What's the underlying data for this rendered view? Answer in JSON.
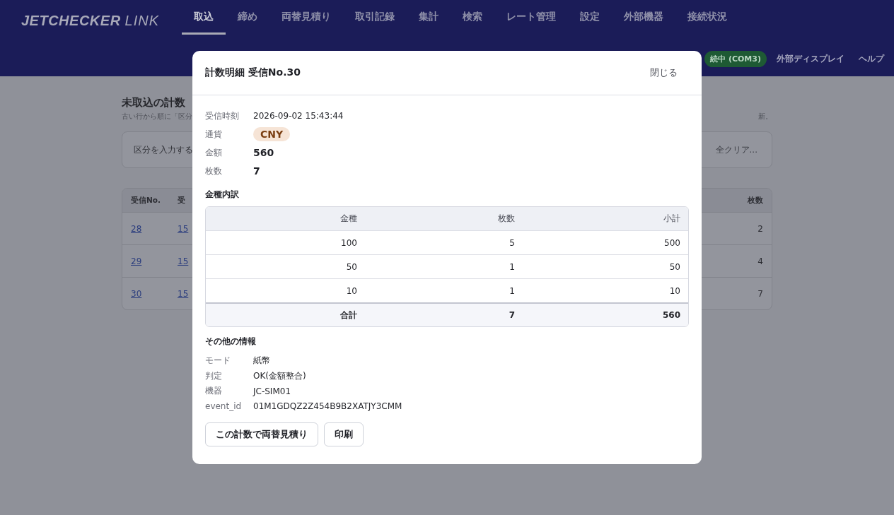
{
  "header": {
    "logo": {
      "strong": "JETCHECKER",
      "light": "LINK"
    },
    "tabs": [
      {
        "label": "取込",
        "selected": true
      },
      {
        "label": "締め",
        "selected": false
      },
      {
        "label": "両替見積り",
        "selected": false
      },
      {
        "label": "取引記録",
        "selected": false
      },
      {
        "label": "集計",
        "selected": false
      },
      {
        "label": "検索",
        "selected": false
      },
      {
        "label": "レート管理",
        "selected": false
      },
      {
        "label": "設定",
        "selected": false
      },
      {
        "label": "外部機器",
        "selected": false
      },
      {
        "label": "接続状況",
        "selected": false
      }
    ],
    "status": "続中 (COM3)",
    "links": [
      "外部ディスプレイ",
      "ヘルプ"
    ]
  },
  "page": {
    "title": "未取込の計数",
    "subtitle_left": "古い行から順に「区分",
    "subtitle_right": "新。",
    "filter": {
      "label": "区分を入力する",
      "button": "全クリア..."
    },
    "table": {
      "columns": [
        "受信No.",
        "受",
        "枚数"
      ],
      "rows": [
        {
          "no": "28",
          "time": "15",
          "count": "2"
        },
        {
          "no": "29",
          "time": "15",
          "count": "4"
        },
        {
          "no": "30",
          "time": "15",
          "count": "7"
        }
      ]
    }
  },
  "dialog": {
    "title": "計数明細 受信No.30",
    "close": "閉じる",
    "fields": [
      {
        "label": "受信時刻",
        "value": "2026-09-02 15:43:44",
        "kind": "text"
      },
      {
        "label": "通貨",
        "value": "CNY",
        "kind": "badge"
      },
      {
        "label": "金額",
        "value": "560",
        "kind": "strong"
      },
      {
        "label": "枚数",
        "value": "7",
        "kind": "strong"
      }
    ],
    "breakdown": {
      "title": "金種内訳",
      "columns": [
        "金種",
        "枚数",
        "小計"
      ],
      "rows": [
        [
          "100",
          "5",
          "500"
        ],
        [
          "50",
          "1",
          "50"
        ],
        [
          "10",
          "1",
          "10"
        ]
      ],
      "total": [
        "合計",
        "7",
        "560"
      ]
    },
    "other": {
      "title": "その他の情報",
      "items": [
        {
          "label": "モード",
          "value": "紙幣"
        },
        {
          "label": "判定",
          "value": "OK(金額整合)"
        },
        {
          "label": "機器",
          "value": "JC-SIM01"
        },
        {
          "label": "event_id",
          "value": "01M1GDQZ2Z454B9B2XATJY3CMM"
        }
      ]
    },
    "buttons": [
      "この計数で両替見積り",
      "印刷"
    ]
  }
}
